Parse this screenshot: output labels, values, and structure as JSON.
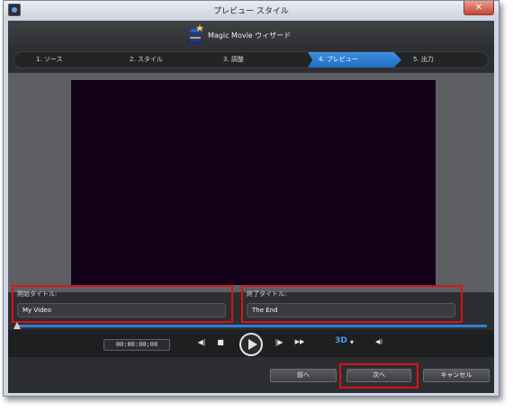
{
  "window": {
    "title": "プレビュー スタイル",
    "close_label": "✕"
  },
  "header": {
    "app_name": "Magic Movie ウィザード"
  },
  "steps": [
    {
      "label": "1. ソース",
      "active": false
    },
    {
      "label": "2. スタイル",
      "active": false
    },
    {
      "label": "3. 調整",
      "active": false
    },
    {
      "label": "4. プレビュー",
      "active": true
    },
    {
      "label": "5. 出力",
      "active": false
    }
  ],
  "opening_title": {
    "label": "開始タイトル:",
    "value": "My Video"
  },
  "ending_title": {
    "label": "終了タイトル:",
    "value": "The End"
  },
  "player": {
    "timecode": "00:00:00;00",
    "prev_icon": "◀|",
    "stop_icon": "■",
    "next_icon": "|▶",
    "fast_forward_icon": "▶▶",
    "mode_3d_label": "3D",
    "mode_3d_dropdown": "▾",
    "volume_icon": "◀)",
    "progress": 0.0
  },
  "footer": {
    "back_label": "前へ",
    "next_label": "次へ",
    "cancel_label": "キャンセル"
  },
  "colors": {
    "accent": "#2f7fd6",
    "highlight": "#d9131b",
    "background": "#2d2e31",
    "preview_bg": "#13021a"
  }
}
